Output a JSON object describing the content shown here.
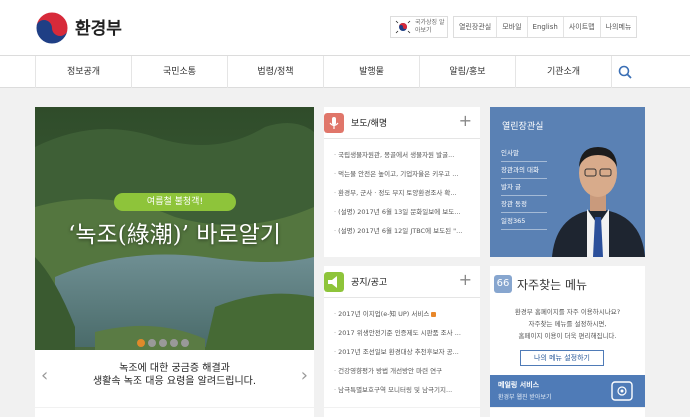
{
  "header": {
    "logo_text": "환경부",
    "flag_text": "국가상징 알아보기",
    "top_links": [
      "열린장관실",
      "모바일",
      "English",
      "사이트맵",
      "나의메뉴"
    ]
  },
  "gnb": {
    "menu": [
      "정보공개",
      "국민소통",
      "법령/정책",
      "발행물",
      "알림/홍보",
      "기관소개"
    ]
  },
  "banner": {
    "badge": "여름철 불청객!",
    "headline": "‘녹조(綠潮)’ 바로알기",
    "caption_line1": "녹조에 대한 궁금증 해결과",
    "caption_line2": "생활속 녹조 대응 요령을 알려드립니다.",
    "prev": "‹",
    "next": "›"
  },
  "press": {
    "title": "보도/해명",
    "plus": "+",
    "items": [
      "국립생물자원관, 몽골에서 생물자원 발굴...",
      "먹는물 안전은 높이고, 기업자율은 키우고 ...",
      "환경부, 군사 · 정도 부지 토양환경조사 확...",
      "(설명) 2017년 6월 13일 문화일보에 보도...",
      "(설명) 2017년 6월 12일 JTBC에 보도된 \"..."
    ]
  },
  "notice": {
    "title": "공지/공고",
    "plus": "+",
    "items": [
      "2017년 이지업(e-知 UP) 서비스",
      "2017 위생안전기준 인증제도 시판품 조사 ...",
      "2017년 조선일보 환경대상 추천후보자 공...",
      "건강영향평가 방법 개선방안 마련 연구",
      "남극특별보호구역 모니터링 및 남극기지..."
    ]
  },
  "minister": {
    "title": "열린장관실",
    "menu": [
      "인사말",
      "장관과의 대화",
      "발자 글",
      "장관 동정",
      "일정365"
    ]
  },
  "faq": {
    "title": "자주찾는 메뉴",
    "icon": "66",
    "desc1": "환경부 홈페이지를 자주 이용하시나요?",
    "desc2": "자주찾는 메뉴를 설정하시면,",
    "desc3": "홈페이지 이용이 더욱 편리해집니다.",
    "button": "나의 메뉴 설정하기",
    "bar_title": "메일링 서비스",
    "bar_sub": "환경부 웹진 받아보기"
  },
  "colors": {
    "press_icon": "#e0766a",
    "notice_icon": "#8ec43a",
    "accent_blue": "#4f7bb7"
  },
  "icons": [
    "taegeuk-logo-icon",
    "korea-flag-icon",
    "search-icon",
    "megaphone-icon",
    "speaker-icon",
    "quote-icon",
    "mail-icon"
  ]
}
